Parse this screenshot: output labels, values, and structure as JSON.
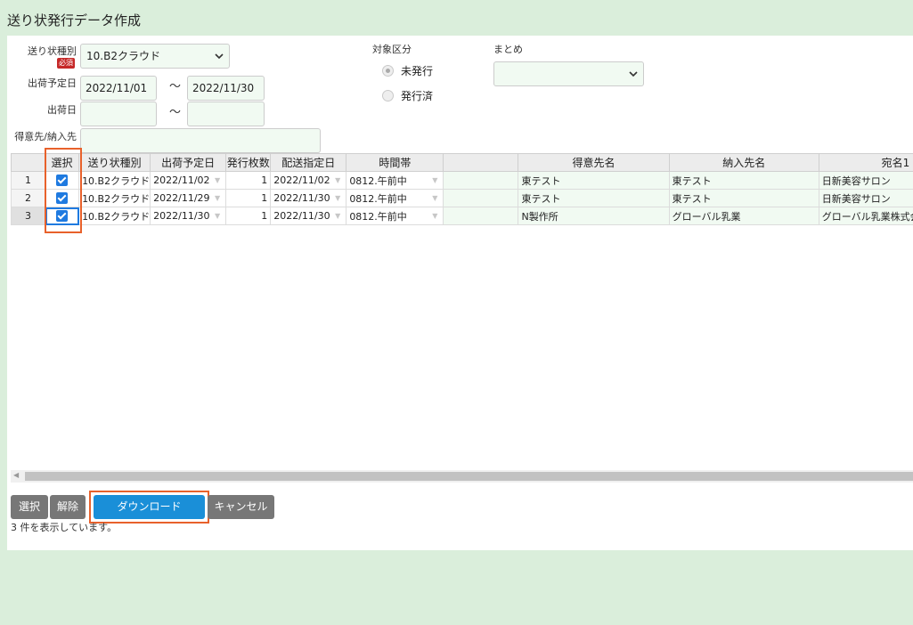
{
  "page": {
    "title": "送り状発行データ作成"
  },
  "form": {
    "type_label": "送り状種別",
    "required_badge": "必須",
    "type_value": "10.B2クラウド",
    "ship_date_label": "出荷予定日",
    "ship_date_from": "2022/11/01",
    "ship_date_to": "2022/11/30",
    "shipped_label": "出荷日",
    "customer_label": "得意先/納入先",
    "tilde": "～",
    "target_label": "対象区分",
    "radio_unissued": "未発行",
    "radio_issued": "発行済",
    "matome_label": "まとめ"
  },
  "grid": {
    "headers": [
      "選択",
      "送り状種別",
      "出荷予定日",
      "発行枚数",
      "配送指定日",
      "時間帯",
      "",
      "得意先名",
      "納入先名",
      "宛名1"
    ],
    "rows": [
      {
        "no": "1",
        "type": "10.B2クラウド",
        "ship": "2022/11/02",
        "count": "1",
        "deliv": "2022/11/02",
        "time": "0812.午前中",
        "cust": "東テスト",
        "dest": "東テスト",
        "addr": "日新美容サロン"
      },
      {
        "no": "2",
        "type": "10.B2クラウド",
        "ship": "2022/11/29",
        "count": "1",
        "deliv": "2022/11/30",
        "time": "0812.午前中",
        "cust": "東テスト",
        "dest": "東テスト",
        "addr": "日新美容サロン"
      },
      {
        "no": "3",
        "type": "10.B2クラウド",
        "ship": "2022/11/30",
        "count": "1",
        "deliv": "2022/11/30",
        "time": "0812.午前中",
        "cust": "N製作所",
        "dest": "グローバル乳業",
        "addr": "グローバル乳業株式会社"
      }
    ]
  },
  "buttons": {
    "select": "選択",
    "clear": "解除",
    "download": "ダウンロード",
    "cancel": "キャンセル"
  },
  "status": "3 件を表示しています。",
  "colors": {
    "accent": "#1a8fd8",
    "highlight": "#e8612b",
    "check": "#1f7ae0"
  }
}
